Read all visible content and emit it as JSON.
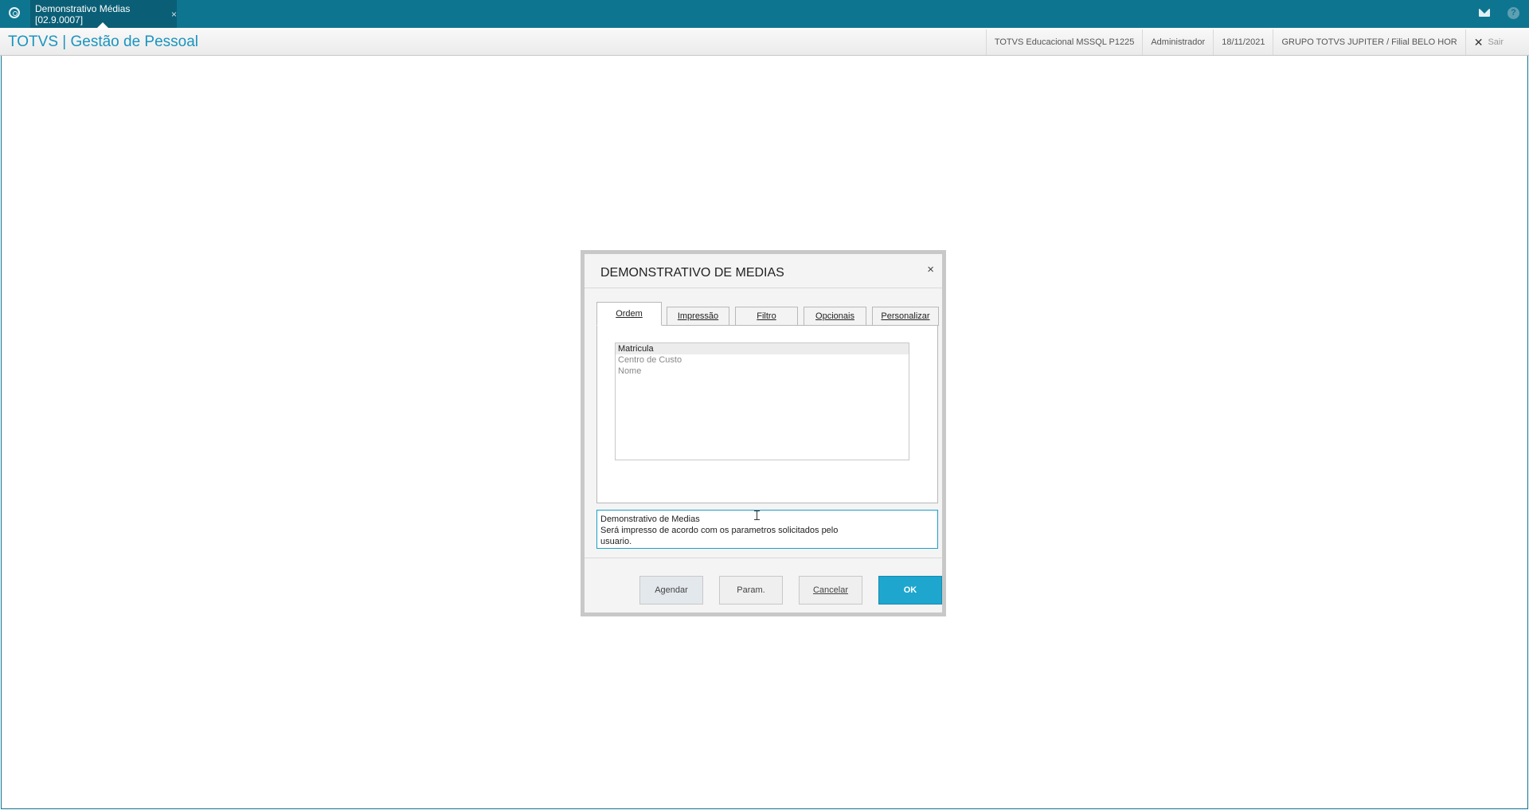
{
  "topbar": {
    "tab_label": "Demonstrativo Médias [02.9.0007]",
    "tab_close": "×",
    "mail_icon": "mail-icon",
    "help_icon_glyph": "?"
  },
  "header": {
    "title": "TOTVS | Gestão de Pessoal",
    "environment": "TOTVS Educacional MSSQL P1225",
    "user": "Administrador",
    "date": "18/11/2021",
    "company": "GRUPO TOTVS JUPITER / Filial BELO HOR",
    "exit_label": "Sair",
    "exit_glyph": "✕"
  },
  "dialog": {
    "title": "DEMONSTRATIVO DE MEDIAS",
    "close": "×",
    "tabs": [
      {
        "label": "Ordem",
        "active": true
      },
      {
        "label": "Impressão",
        "active": false
      },
      {
        "label": "Filtro",
        "active": false
      },
      {
        "label": "Opcionais",
        "active": false
      },
      {
        "label": "Personalizar",
        "active": false
      }
    ],
    "order_list": {
      "items": [
        "Matricula",
        "Centro de Custo",
        "Nome"
      ],
      "selected": "Matricula"
    },
    "description": {
      "line1": "Demonstrativo de Medias",
      "line2": "Será impresso de acordo com os parametros solicitados pelo",
      "line3": "usuario."
    },
    "buttons": {
      "schedule": "Agendar",
      "params": "Param.",
      "cancel": "Cancelar",
      "ok": "OK"
    }
  },
  "colors": {
    "topbar": "#0e7590",
    "accent": "#1ea6cf",
    "title_text": "#1a94bf"
  }
}
